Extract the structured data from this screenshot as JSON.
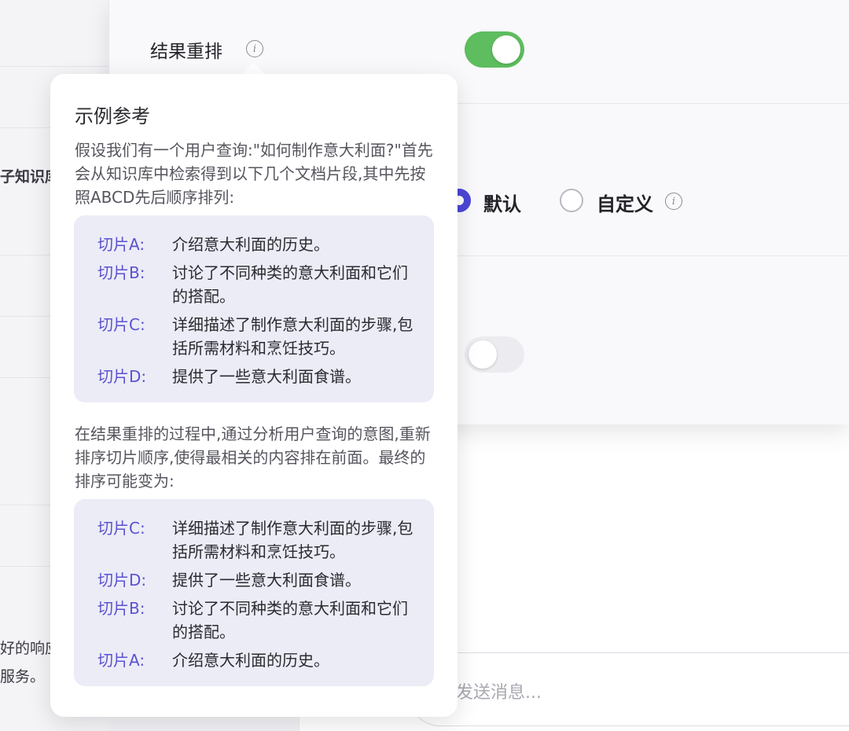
{
  "background": {
    "left_fragments": [
      "子知识库",
      "好的响应",
      "服务。"
    ]
  },
  "settings": {
    "rerank_label": "结果重排",
    "rerank_enabled": true,
    "options": [
      {
        "label": "默认",
        "selected": true
      },
      {
        "label": "自定义",
        "selected": false
      }
    ],
    "second_toggle_enabled": false
  },
  "chat": {
    "input_placeholder": "发送消息..."
  },
  "popover": {
    "title": "示例参考",
    "intro": "假设我们有一个用户查询:\"如何制作意大利面?\"首先会从知识库中检索得到以下几个文档片段,其中先按照ABCD先后顺序排列:",
    "original_order": [
      {
        "label": "切片A:",
        "text": "介绍意大利面的历史。"
      },
      {
        "label": "切片B:",
        "text": "讨论了不同种类的意大利面和它们的搭配。"
      },
      {
        "label": "切片C:",
        "text": "详细描述了制作意大利面的步骤,包括所需材料和烹饪技巧。"
      },
      {
        "label": "切片D:",
        "text": "提供了一些意大利面食谱。"
      }
    ],
    "middle": "在结果重排的过程中,通过分析用户查询的意图,重新排序切片顺序,使得最相关的内容排在前面。最终的排序可能变为:",
    "reranked_order": [
      {
        "label": "切片C:",
        "text": "详细描述了制作意大利面的步骤,包括所需材料和烹饪技巧。"
      },
      {
        "label": "切片D:",
        "text": "提供了一些意大利面食谱。"
      },
      {
        "label": "切片B:",
        "text": "讨论了不同种类的意大利面和它们的搭配。"
      },
      {
        "label": "切片A:",
        "text": "介绍意大利面的历史。"
      }
    ]
  },
  "colors": {
    "accent": "#4b46d6",
    "toggle_on": "#5ebd5e",
    "chunk_label": "#5a52cf",
    "chunk_bg": "#ececf7"
  },
  "icons": [
    "info-icon"
  ]
}
